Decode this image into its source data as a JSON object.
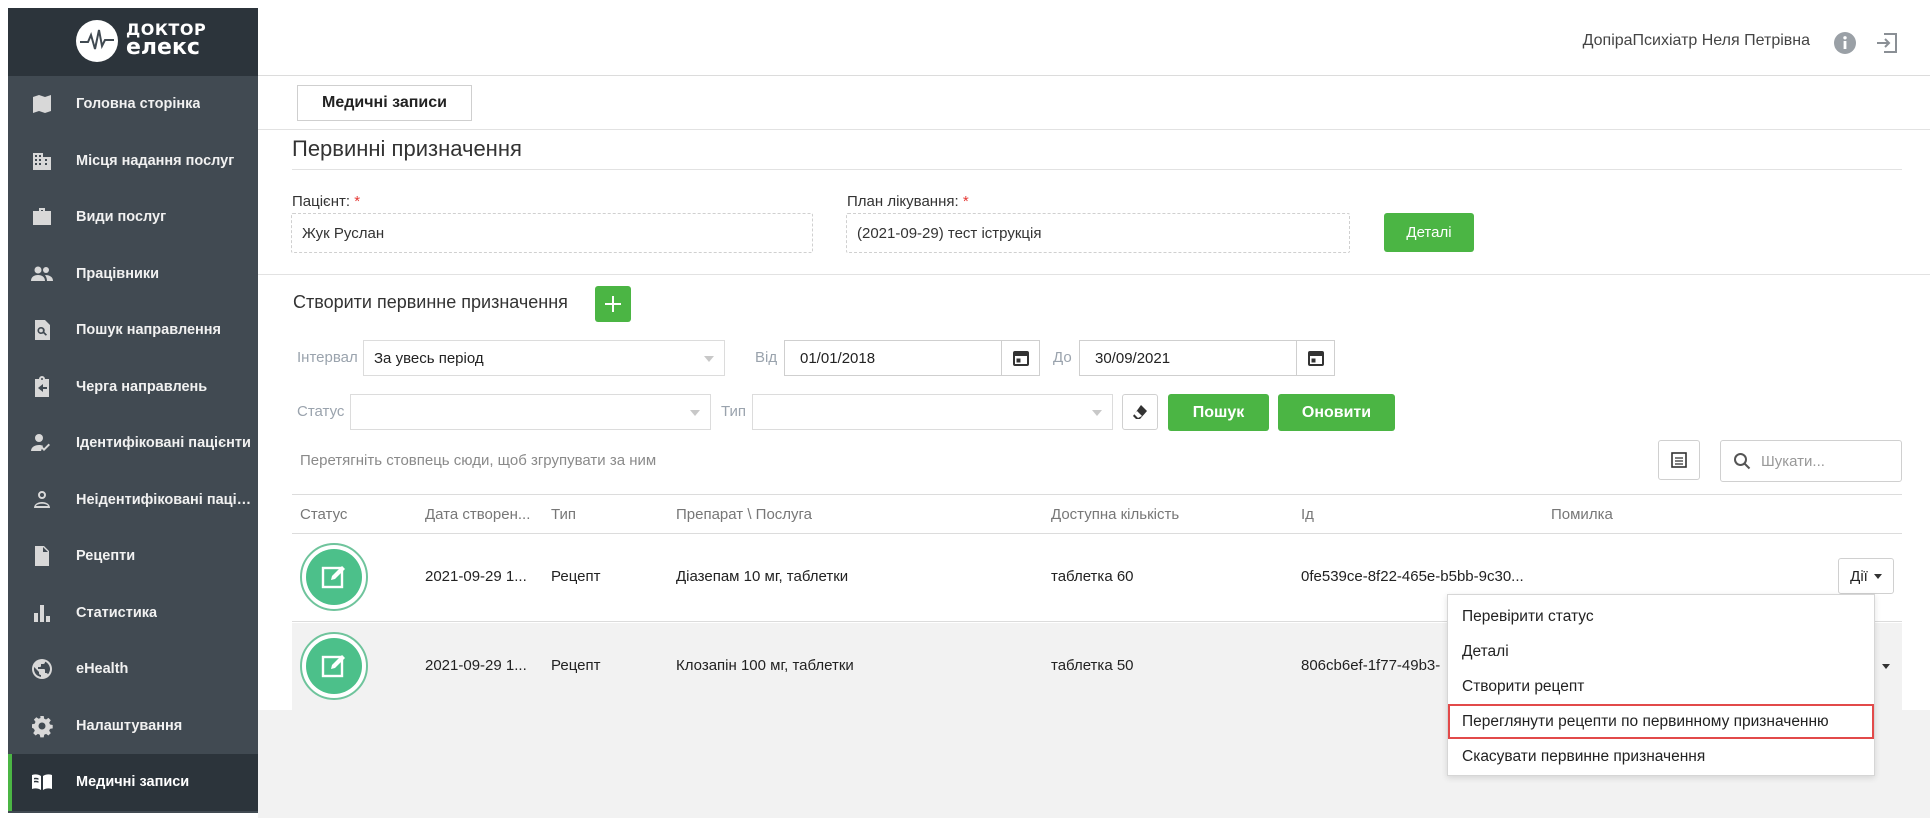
{
  "logo": {
    "line1": "ДОКТОР",
    "line2": "елекс"
  },
  "sidebar": {
    "items": [
      {
        "label": "Головна сторінка",
        "icon": "map-icon"
      },
      {
        "label": "Місця надання послуг",
        "icon": "building-icon"
      },
      {
        "label": "Види послуг",
        "icon": "briefcase-icon"
      },
      {
        "label": "Працівники",
        "icon": "people-icon"
      },
      {
        "label": "Пошук направлення",
        "icon": "doc-search-icon"
      },
      {
        "label": "Черга направлень",
        "icon": "clipboard-arrow-icon"
      },
      {
        "label": "Ідентифіковані пацієнти",
        "icon": "person-check-icon"
      },
      {
        "label": "Неідентифіковані пацієнти",
        "icon": "person-outline-icon"
      },
      {
        "label": "Рецепти",
        "icon": "document-icon"
      },
      {
        "label": "Статистика",
        "icon": "bar-chart-icon"
      },
      {
        "label": "eHealth",
        "icon": "globe-icon"
      },
      {
        "label": "Налаштування",
        "icon": "gear-icon"
      },
      {
        "label": "Медичні записи",
        "icon": "book-icon",
        "active": true
      }
    ]
  },
  "header": {
    "user_name": "ДопіраПсихіатр Неля Петрівна"
  },
  "tab": {
    "label": "Медичні записи"
  },
  "page": {
    "title": "Первинні призначення",
    "patient_label": "Пацієнт:",
    "patient_value": "Жук Руслан",
    "plan_label": "План лікування:",
    "plan_value": "(2021-09-29) тест іструкція",
    "required_mark": "*",
    "details_button": "Деталі",
    "create_label": "Створити первинне призначення"
  },
  "filters": {
    "interval_label": "Інтервал",
    "interval_value": "За увесь період",
    "from_label": "Від",
    "from_value": "01/01/2018",
    "to_label": "До",
    "to_value": "30/09/2021",
    "status_label": "Статус",
    "type_label": "Тип",
    "search_button": "Пошук",
    "refresh_button": "Оновити"
  },
  "grid": {
    "group_hint": "Перетягніть стовпець сюди, щоб згрупувати за ним",
    "search_placeholder": "Шукати...",
    "columns": [
      "Статус",
      "Дата створен...",
      "Тип",
      "Препарат \\ Послуга",
      "Доступна кількість",
      "Ід",
      "Помилка"
    ],
    "rows": [
      {
        "date": "2021-09-29 1...",
        "type": "Рецепт",
        "drug": "Діазепам 10 мг, таблетки",
        "qty": "таблетка 60",
        "id": "0fe539ce-8f22-465e-b5bb-9c30...",
        "error": ""
      },
      {
        "date": "2021-09-29 1...",
        "type": "Рецепт",
        "drug": "Клозапін 100 мг, таблетки",
        "qty": "таблетка 50",
        "id": "806cb6ef-1f77-49b3-",
        "error": ""
      }
    ],
    "actions_label": "Дії"
  },
  "menu": {
    "items": [
      "Перевірити статус",
      "Деталі",
      "Створити рецепт",
      "Переглянути рецепти по первинному призначенню",
      "Скасувати первинне призначення"
    ],
    "highlighted_index": 3
  },
  "colors": {
    "sidebar": "#414a52",
    "accent_green": "#4bb544",
    "status_green": "#4cc08a",
    "highlight_red": "#e24a4a"
  }
}
